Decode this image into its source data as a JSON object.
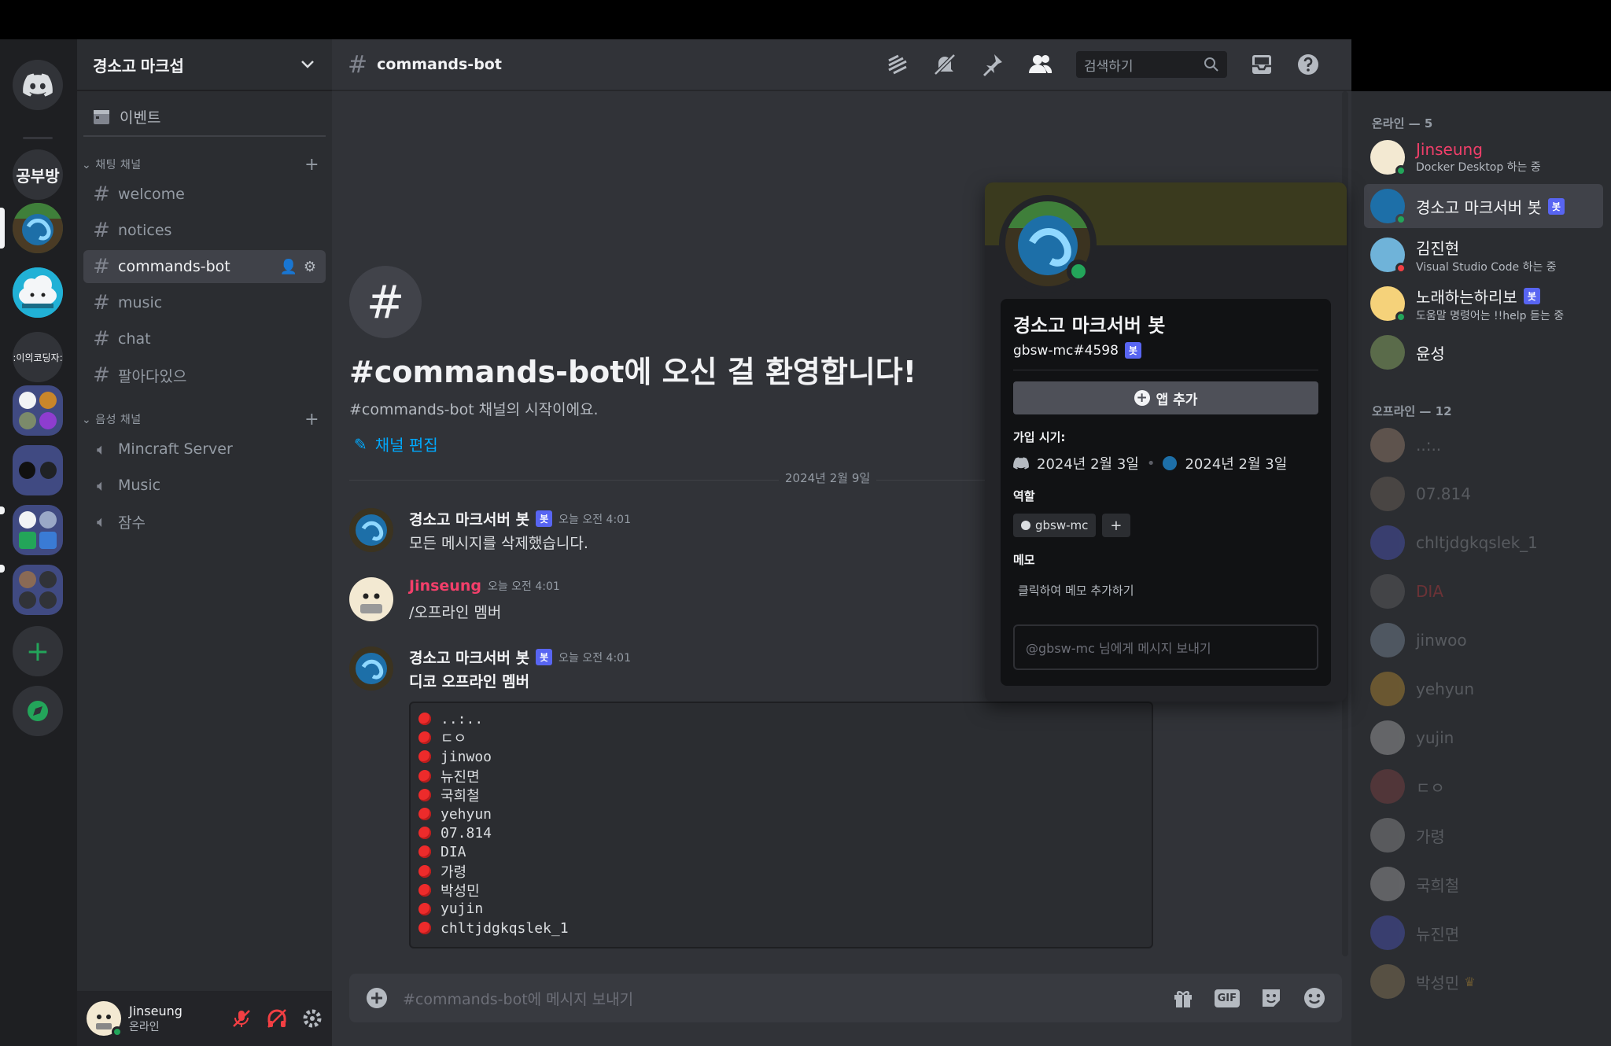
{
  "rail": {
    "home_label": "Discord",
    "servers": [
      {
        "name": "공부방"
      },
      {
        "name": "경소고 마크섭"
      },
      {
        "name": "cloud server"
      },
      {
        "name": ":이의코딩자:"
      }
    ]
  },
  "sidebar": {
    "guild_name": "경소고 마크섭",
    "events_label": "이벤트",
    "text_category": "채팅 채널",
    "text_channels": [
      "welcome",
      "notices",
      "commands-bot",
      "music",
      "chat",
      "팔아다있으"
    ],
    "voice_category": "음성 채널",
    "voice_channels": [
      "Mincraft Server",
      "Music",
      "잠수"
    ]
  },
  "user_panel": {
    "name": "Jinseung",
    "status": "온라인"
  },
  "header": {
    "channel": "commands-bot",
    "search_placeholder": "검색하기"
  },
  "chat": {
    "welcome_title": "#commands-bot에 오신 걸 환영합니다!",
    "welcome_sub": "#commands-bot 채널의 시작이에요.",
    "edit_channel": "채널 편집",
    "date_divider": "2024년 2월 9일",
    "bot_tag": "봇",
    "messages": [
      {
        "author": "경소고 마크서버 봇",
        "time": "오늘 오전 4:01",
        "text": "모든 메시지를 삭제했습니다."
      },
      {
        "author": "Jinseung",
        "time": "오늘 오전 4:01",
        "text": "/오프라인 멤버"
      },
      {
        "author": "경소고 마크서버 봇",
        "time": "오늘 오전 4:01",
        "text": "디코 오프라인 멤버"
      }
    ],
    "offline_list": [
      "..:..",
      "ㄷㅇ",
      "jinwoo",
      "뉴진면",
      "국희철",
      "yehyun",
      "07.814",
      "DIA",
      "가령",
      "박성민",
      "yujin",
      "chltjdgkqslek_1"
    ],
    "composer_placeholder": "#commands-bot에 메시지 보내기",
    "gif_label": "GIF"
  },
  "members": {
    "online_header": "온라인 — 5",
    "online": [
      {
        "name": "Jinseung",
        "activity": "Docker Desktop 하는 중",
        "color": "#f23f6a"
      },
      {
        "name": "경소고 마크서버 봇",
        "activity": "",
        "color": "#f2f3f5"
      },
      {
        "name": "김진현",
        "activity": "Visual Studio Code 하는 중",
        "color": "#f2f3f5"
      },
      {
        "name": "노래하는하리보",
        "activity": "도움말 명령어는 !!help 듣는 중",
        "color": "#f2f3f5"
      },
      {
        "name": "윤성",
        "activity": "",
        "color": "#f2f3f5"
      }
    ],
    "offline_header": "오프라인 — 12",
    "offline": [
      "..:..",
      "07.814",
      "chltjdgkqslek_1",
      "DIA",
      "jinwoo",
      "yehyun",
      "yujin",
      "ㄷㅇ",
      "가령",
      "국희철",
      "뉴진면",
      "박성민"
    ]
  },
  "profile": {
    "name": "경소고 마크서버 봇",
    "tag": "gbsw-mc#4598",
    "add_app": "앱 추가",
    "joined_header": "가입 시기:",
    "joined_discord": "2024년 2월 3일",
    "joined_server": "2024년 2월 3일",
    "roles_header": "역할",
    "role": "gbsw-mc",
    "memo_header": "메모",
    "memo_placeholder": "클릭하여 메모 추가하기",
    "dm_placeholder": "@gbsw-mc 님에게 메시지 보내기"
  },
  "colors": {
    "online": "#23a55a",
    "dnd": "#f23f43",
    "brand": "#5865f2",
    "link": "#00a8fc"
  }
}
